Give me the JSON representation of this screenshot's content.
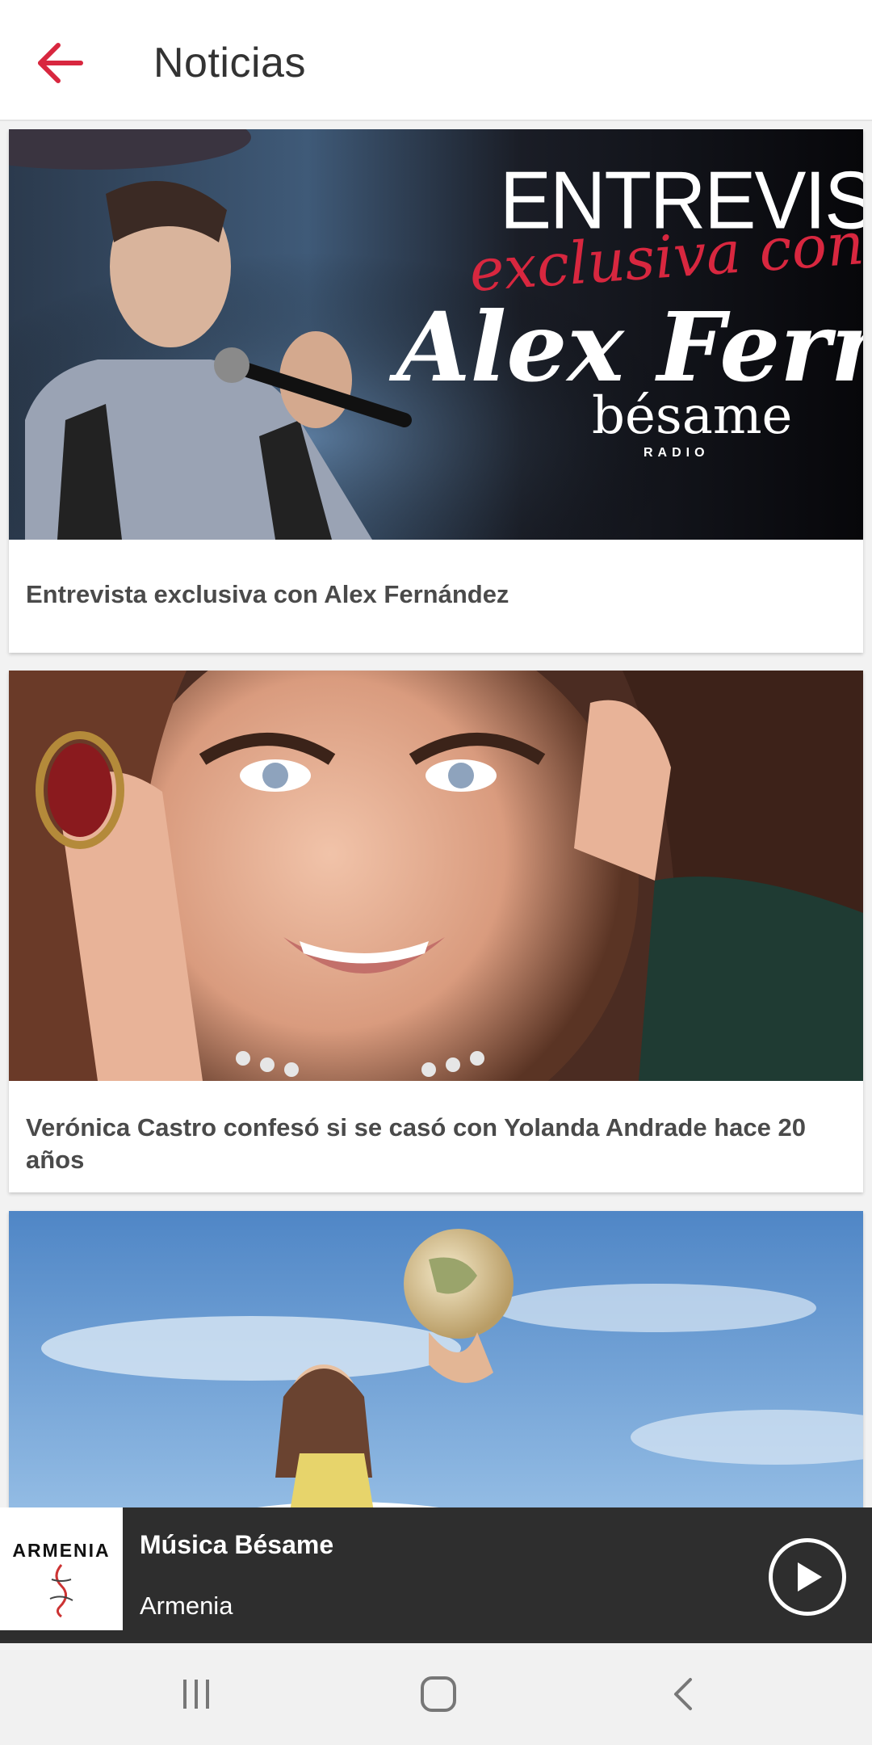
{
  "app_bar": {
    "title": "Noticias",
    "back_icon": "arrow-left-icon",
    "accent_color": "#d8273f"
  },
  "news": [
    {
      "caption": "Entrevista exclusiva con Alex Fernández",
      "image": {
        "headline_line1": "ENTREVISTA",
        "headline_line2": "exclusiva con",
        "name": "Alex Fernánd",
        "brand": "bésame",
        "brand_sub": "RADIO"
      }
    },
    {
      "caption": "Verónica Castro confesó si se casó con Yolanda Andrade hace 20 años"
    },
    {
      "caption": ""
    }
  ],
  "player": {
    "station_logo_text": "ARMENIA",
    "title": "Música Bésame",
    "subtitle": "Armenia",
    "play_icon": "play-icon"
  },
  "system_nav": {
    "recents_icon": "recents-icon",
    "home_icon": "home-icon",
    "back_icon": "back-chevron-icon"
  }
}
